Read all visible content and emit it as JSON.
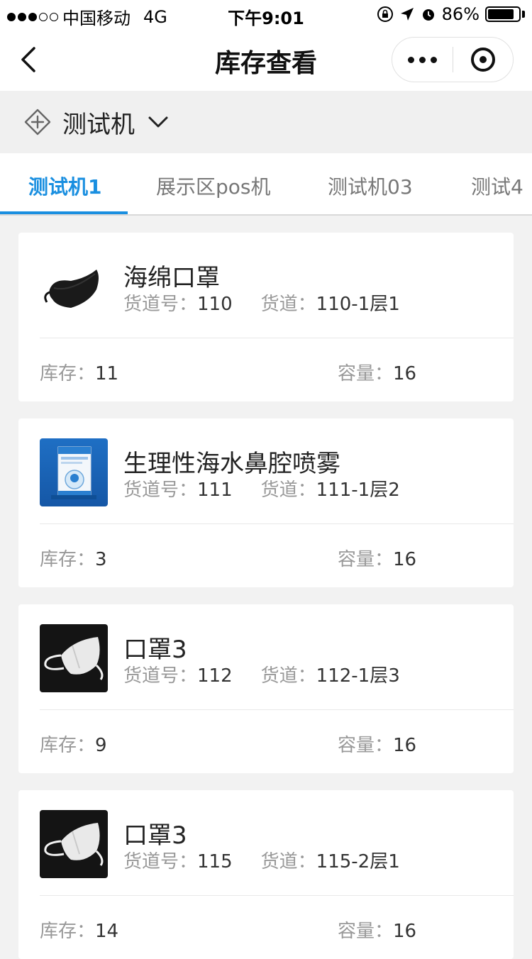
{
  "status_bar": {
    "carrier": "中国移动",
    "network": "4G",
    "time": "下午9:01",
    "battery": "86%",
    "battery_level": 0.86
  },
  "nav": {
    "title": "库存查看"
  },
  "device": {
    "name": "测试机"
  },
  "tabs": [
    {
      "label": "测试机1",
      "active": true
    },
    {
      "label": "展示区pos机",
      "active": false
    },
    {
      "label": "测试机03",
      "active": false
    },
    {
      "label": "测试4",
      "active": false
    }
  ],
  "labels": {
    "slot_no": "货道号：",
    "slot": "货道：",
    "stock": "库存：",
    "capacity": "容量："
  },
  "items": [
    {
      "name": "海绵口罩",
      "slot_no": "110",
      "slot": "110-1层1",
      "stock": "11",
      "capacity": "16",
      "thumb": "mask-black"
    },
    {
      "name": "生理性海水鼻腔喷雾",
      "slot_no": "111",
      "slot": "111-1层2",
      "stock": "3",
      "capacity": "16",
      "thumb": "nasal-spray-box"
    },
    {
      "name": "口罩3",
      "slot_no": "112",
      "slot": "112-1层3",
      "stock": "9",
      "capacity": "16",
      "thumb": "mask-white"
    },
    {
      "name": "口罩3",
      "slot_no": "115",
      "slot": "115-2层1",
      "stock": "14",
      "capacity": "16",
      "thumb": "mask-white"
    }
  ]
}
